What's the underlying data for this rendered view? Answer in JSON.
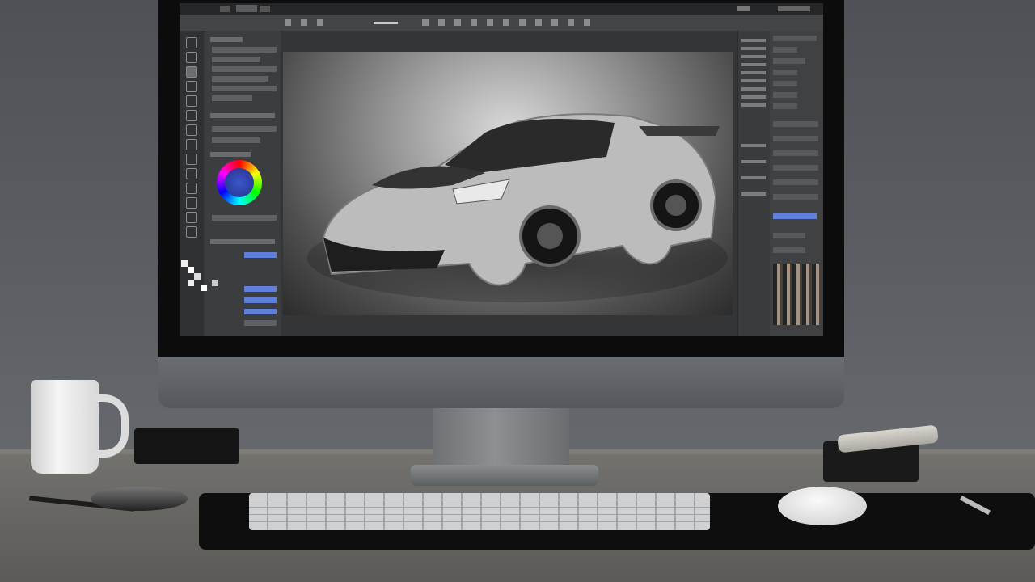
{
  "scene": {
    "description_items": [
      "monitor",
      "keyboard",
      "mouse",
      "mug",
      "speaker",
      "glasses",
      "phone"
    ]
  },
  "app": {
    "menu": [
      "",
      "",
      "",
      "",
      ""
    ],
    "active_menu_index": 3
  },
  "speaker": {
    "label": ""
  },
  "colors": {
    "wall": "#55585c",
    "desk": "#6a6864",
    "app_bg": "#3a3b3d",
    "accent_blue": "#5f7fd8"
  },
  "icons": [
    "color-wheel-icon",
    "layer-thumbnails-icon"
  ]
}
